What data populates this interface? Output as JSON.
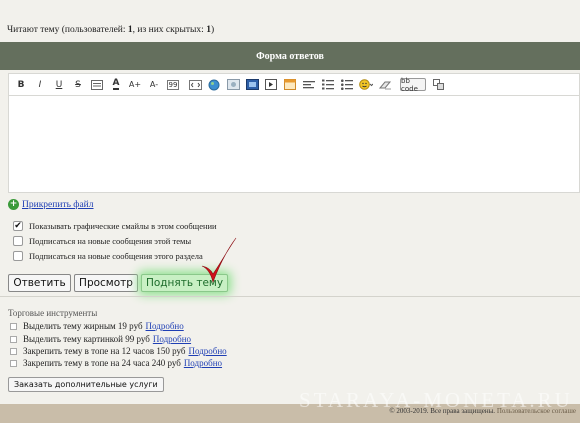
{
  "reading": {
    "prefix": "Читают тему (пользователей: ",
    "users": "1",
    "middle": ", из них скрытых: ",
    "hidden": "1",
    "suffix": ")"
  },
  "reply_form": {
    "title": "Форма ответов"
  },
  "toolbar": {
    "bold": "B",
    "italic": "I",
    "underline": "U",
    "strike": "S",
    "font_color": "A",
    "font_size_up": "A+",
    "font_size_down": "A-",
    "quote": "99",
    "bbcode_label": "bb code"
  },
  "attach": {
    "label": "Прикрепить файл"
  },
  "options": [
    {
      "label": "Показывать графические смайлы в этом сообщении",
      "checked": true
    },
    {
      "label": "Подписаться на новые сообщения этой темы",
      "checked": false
    },
    {
      "label": "Подписаться на новые сообщения этого раздела",
      "checked": false
    }
  ],
  "buttons": {
    "reply": "Ответить",
    "preview": "Просмотр",
    "raise": "Поднять тему"
  },
  "trade": {
    "title": "Торговые инструменты",
    "items": [
      {
        "label": "Выделить тему жирным 19 руб",
        "link": "Подробно"
      },
      {
        "label": "Выделить тему картинкой 99 руб",
        "link": "Подробно"
      },
      {
        "label": "Закрепить тему в топе на 12 часов 150 руб",
        "link": "Подробно"
      },
      {
        "label": "Закрепить тему в топе на 24 часа 240 руб",
        "link": "Подробно"
      }
    ],
    "order_button": "Заказать дополнительные услуги"
  },
  "watermark": "STARAYA-MONETA.RU",
  "footer": {
    "copyright": "© 2003-2019. Все права защищены. ",
    "agreement": "Пользовательское соглаше"
  },
  "colors": {
    "header": "#646f5d",
    "footer": "#c9bda9",
    "link": "#1f3fb4",
    "raise_glow": "#8fe28f",
    "checkmark": "#d0121a"
  }
}
